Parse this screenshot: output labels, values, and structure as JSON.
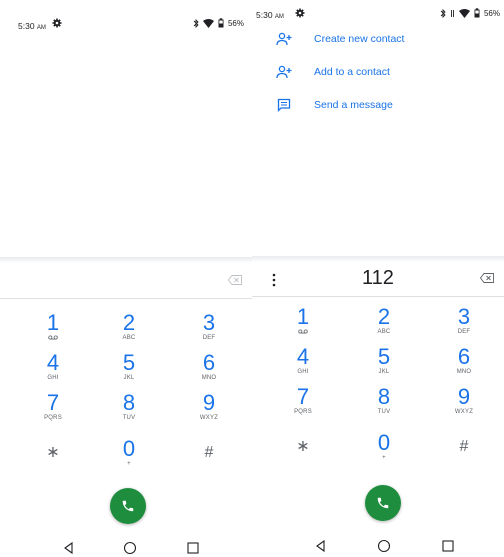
{
  "left": {
    "status": {
      "time": "5:30",
      "ampm": "AM",
      "battery": "56%"
    },
    "digits": "",
    "keys": [
      {
        "num": "1",
        "sub": "voicemail-icon"
      },
      {
        "num": "2",
        "sub": "ABC"
      },
      {
        "num": "3",
        "sub": "DEF"
      },
      {
        "num": "4",
        "sub": "GHI"
      },
      {
        "num": "5",
        "sub": "JKL"
      },
      {
        "num": "6",
        "sub": "MNO"
      },
      {
        "num": "7",
        "sub": "PQRS"
      },
      {
        "num": "8",
        "sub": "TUV"
      },
      {
        "num": "9",
        "sub": "WXYZ"
      },
      {
        "num": "*",
        "sub": ""
      },
      {
        "num": "0",
        "sub": "+"
      },
      {
        "num": "#",
        "sub": ""
      }
    ]
  },
  "right": {
    "status": {
      "time": "5:30",
      "ampm": "AM",
      "battery": "56%"
    },
    "actions": [
      {
        "label": "Create new contact",
        "icon": "add-person-icon"
      },
      {
        "label": "Add to a contact",
        "icon": "add-person-icon"
      },
      {
        "label": "Send a message",
        "icon": "message-icon"
      }
    ],
    "digits": "112",
    "keys": [
      {
        "num": "1",
        "sub": "voicemail-icon"
      },
      {
        "num": "2",
        "sub": "ABC"
      },
      {
        "num": "3",
        "sub": "DEF"
      },
      {
        "num": "4",
        "sub": "GHI"
      },
      {
        "num": "5",
        "sub": "JKL"
      },
      {
        "num": "6",
        "sub": "MNO"
      },
      {
        "num": "7",
        "sub": "PQRS"
      },
      {
        "num": "8",
        "sub": "TUV"
      },
      {
        "num": "9",
        "sub": "WXYZ"
      },
      {
        "num": "*",
        "sub": ""
      },
      {
        "num": "0",
        "sub": "+"
      },
      {
        "num": "#",
        "sub": ""
      }
    ]
  },
  "colors": {
    "accent": "#1a73e8",
    "call": "#1e8e3e",
    "text": "#202124",
    "muted": "#5f6368"
  }
}
